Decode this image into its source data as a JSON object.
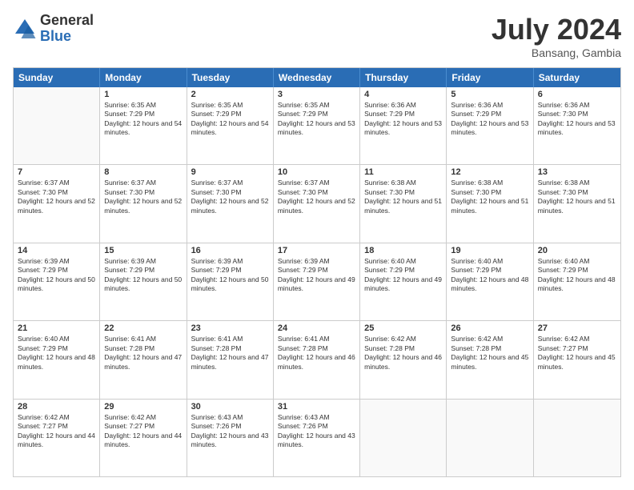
{
  "logo": {
    "general": "General",
    "blue": "Blue"
  },
  "header": {
    "month_year": "July 2024",
    "location": "Bansang, Gambia"
  },
  "weekdays": [
    "Sunday",
    "Monday",
    "Tuesday",
    "Wednesday",
    "Thursday",
    "Friday",
    "Saturday"
  ],
  "rows": [
    [
      {
        "day": "",
        "sunrise": "",
        "sunset": "",
        "daylight": ""
      },
      {
        "day": "1",
        "sunrise": "Sunrise: 6:35 AM",
        "sunset": "Sunset: 7:29 PM",
        "daylight": "Daylight: 12 hours and 54 minutes."
      },
      {
        "day": "2",
        "sunrise": "Sunrise: 6:35 AM",
        "sunset": "Sunset: 7:29 PM",
        "daylight": "Daylight: 12 hours and 54 minutes."
      },
      {
        "day": "3",
        "sunrise": "Sunrise: 6:35 AM",
        "sunset": "Sunset: 7:29 PM",
        "daylight": "Daylight: 12 hours and 53 minutes."
      },
      {
        "day": "4",
        "sunrise": "Sunrise: 6:36 AM",
        "sunset": "Sunset: 7:29 PM",
        "daylight": "Daylight: 12 hours and 53 minutes."
      },
      {
        "day": "5",
        "sunrise": "Sunrise: 6:36 AM",
        "sunset": "Sunset: 7:29 PM",
        "daylight": "Daylight: 12 hours and 53 minutes."
      },
      {
        "day": "6",
        "sunrise": "Sunrise: 6:36 AM",
        "sunset": "Sunset: 7:30 PM",
        "daylight": "Daylight: 12 hours and 53 minutes."
      }
    ],
    [
      {
        "day": "7",
        "sunrise": "Sunrise: 6:37 AM",
        "sunset": "Sunset: 7:30 PM",
        "daylight": "Daylight: 12 hours and 52 minutes."
      },
      {
        "day": "8",
        "sunrise": "Sunrise: 6:37 AM",
        "sunset": "Sunset: 7:30 PM",
        "daylight": "Daylight: 12 hours and 52 minutes."
      },
      {
        "day": "9",
        "sunrise": "Sunrise: 6:37 AM",
        "sunset": "Sunset: 7:30 PM",
        "daylight": "Daylight: 12 hours and 52 minutes."
      },
      {
        "day": "10",
        "sunrise": "Sunrise: 6:37 AM",
        "sunset": "Sunset: 7:30 PM",
        "daylight": "Daylight: 12 hours and 52 minutes."
      },
      {
        "day": "11",
        "sunrise": "Sunrise: 6:38 AM",
        "sunset": "Sunset: 7:30 PM",
        "daylight": "Daylight: 12 hours and 51 minutes."
      },
      {
        "day": "12",
        "sunrise": "Sunrise: 6:38 AM",
        "sunset": "Sunset: 7:30 PM",
        "daylight": "Daylight: 12 hours and 51 minutes."
      },
      {
        "day": "13",
        "sunrise": "Sunrise: 6:38 AM",
        "sunset": "Sunset: 7:30 PM",
        "daylight": "Daylight: 12 hours and 51 minutes."
      }
    ],
    [
      {
        "day": "14",
        "sunrise": "Sunrise: 6:39 AM",
        "sunset": "Sunset: 7:29 PM",
        "daylight": "Daylight: 12 hours and 50 minutes."
      },
      {
        "day": "15",
        "sunrise": "Sunrise: 6:39 AM",
        "sunset": "Sunset: 7:29 PM",
        "daylight": "Daylight: 12 hours and 50 minutes."
      },
      {
        "day": "16",
        "sunrise": "Sunrise: 6:39 AM",
        "sunset": "Sunset: 7:29 PM",
        "daylight": "Daylight: 12 hours and 50 minutes."
      },
      {
        "day": "17",
        "sunrise": "Sunrise: 6:39 AM",
        "sunset": "Sunset: 7:29 PM",
        "daylight": "Daylight: 12 hours and 49 minutes."
      },
      {
        "day": "18",
        "sunrise": "Sunrise: 6:40 AM",
        "sunset": "Sunset: 7:29 PM",
        "daylight": "Daylight: 12 hours and 49 minutes."
      },
      {
        "day": "19",
        "sunrise": "Sunrise: 6:40 AM",
        "sunset": "Sunset: 7:29 PM",
        "daylight": "Daylight: 12 hours and 48 minutes."
      },
      {
        "day": "20",
        "sunrise": "Sunrise: 6:40 AM",
        "sunset": "Sunset: 7:29 PM",
        "daylight": "Daylight: 12 hours and 48 minutes."
      }
    ],
    [
      {
        "day": "21",
        "sunrise": "Sunrise: 6:40 AM",
        "sunset": "Sunset: 7:29 PM",
        "daylight": "Daylight: 12 hours and 48 minutes."
      },
      {
        "day": "22",
        "sunrise": "Sunrise: 6:41 AM",
        "sunset": "Sunset: 7:28 PM",
        "daylight": "Daylight: 12 hours and 47 minutes."
      },
      {
        "day": "23",
        "sunrise": "Sunrise: 6:41 AM",
        "sunset": "Sunset: 7:28 PM",
        "daylight": "Daylight: 12 hours and 47 minutes."
      },
      {
        "day": "24",
        "sunrise": "Sunrise: 6:41 AM",
        "sunset": "Sunset: 7:28 PM",
        "daylight": "Daylight: 12 hours and 46 minutes."
      },
      {
        "day": "25",
        "sunrise": "Sunrise: 6:42 AM",
        "sunset": "Sunset: 7:28 PM",
        "daylight": "Daylight: 12 hours and 46 minutes."
      },
      {
        "day": "26",
        "sunrise": "Sunrise: 6:42 AM",
        "sunset": "Sunset: 7:28 PM",
        "daylight": "Daylight: 12 hours and 45 minutes."
      },
      {
        "day": "27",
        "sunrise": "Sunrise: 6:42 AM",
        "sunset": "Sunset: 7:27 PM",
        "daylight": "Daylight: 12 hours and 45 minutes."
      }
    ],
    [
      {
        "day": "28",
        "sunrise": "Sunrise: 6:42 AM",
        "sunset": "Sunset: 7:27 PM",
        "daylight": "Daylight: 12 hours and 44 minutes."
      },
      {
        "day": "29",
        "sunrise": "Sunrise: 6:42 AM",
        "sunset": "Sunset: 7:27 PM",
        "daylight": "Daylight: 12 hours and 44 minutes."
      },
      {
        "day": "30",
        "sunrise": "Sunrise: 6:43 AM",
        "sunset": "Sunset: 7:26 PM",
        "daylight": "Daylight: 12 hours and 43 minutes."
      },
      {
        "day": "31",
        "sunrise": "Sunrise: 6:43 AM",
        "sunset": "Sunset: 7:26 PM",
        "daylight": "Daylight: 12 hours and 43 minutes."
      },
      {
        "day": "",
        "sunrise": "",
        "sunset": "",
        "daylight": ""
      },
      {
        "day": "",
        "sunrise": "",
        "sunset": "",
        "daylight": ""
      },
      {
        "day": "",
        "sunrise": "",
        "sunset": "",
        "daylight": ""
      }
    ]
  ]
}
